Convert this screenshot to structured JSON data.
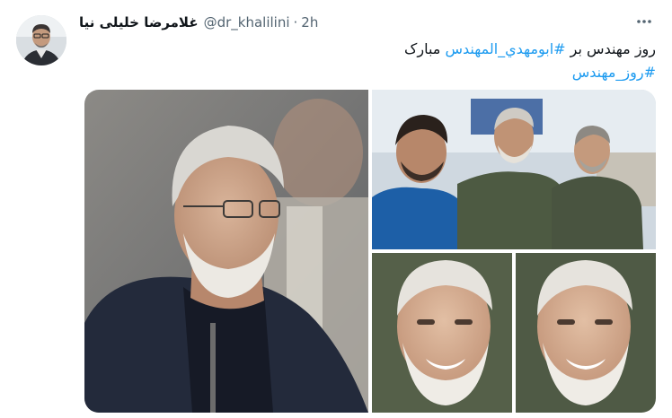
{
  "tweet": {
    "display_name": "غلامرضا خلیلی نیا",
    "handle": "@dr_khalilini",
    "separator": "·",
    "time": "2h",
    "text_part1": "روز مهندس بر ",
    "hashtag1": "#ابومهدي_المهندس",
    "text_part2": " مبارک",
    "hashtag2": "#روز_مهندس"
  },
  "icons": {
    "more": "more-horizontal-icon"
  },
  "colors": {
    "text": "#0f1419",
    "secondary": "#536471",
    "link": "#1d9bf0"
  }
}
